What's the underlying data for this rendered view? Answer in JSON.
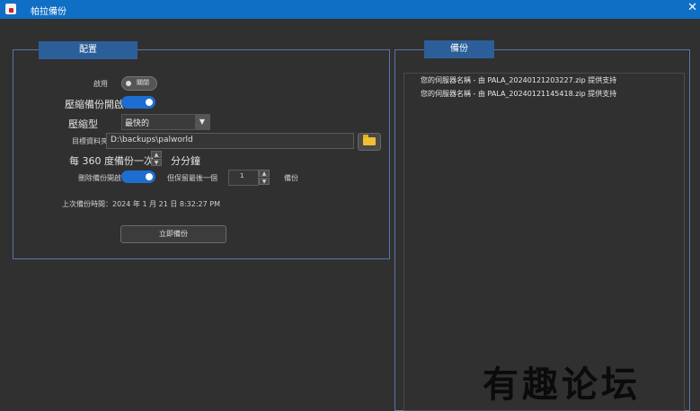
{
  "window": {
    "title": "帕拉備份",
    "close_glyph": "✕"
  },
  "config": {
    "tab_label": "配置",
    "enable": {
      "label": "啟用",
      "toggle_text": "關閉"
    },
    "compress_enable": {
      "label": "壓縮備份開啟"
    },
    "compress_type": {
      "label": "壓縮型",
      "value": "最快的",
      "arrow": "▼"
    },
    "target_folder": {
      "label": "目標資料夾",
      "value": "D:\\backups\\palworld"
    },
    "interval": {
      "prefix": "每",
      "value": "360",
      "suffix": "度備份一次",
      "unit": "分分鐘"
    },
    "delete_backup": {
      "label": "刪除備份開啟",
      "keep_label": "但保留最後一個",
      "keep_value": "1",
      "unit": "備份"
    },
    "last_backup": "上次備份時間：2024 年 1 月 21 日 8:32:27 PM",
    "backup_now": "立即備份"
  },
  "backups": {
    "tab_label": "備份",
    "items": [
      "您的伺服器名稱 - 由 PALA_20240121203227.zip 提供支持",
      "您的伺服器名稱 - 由 PALA_20240121145418.zip 提供支持"
    ]
  },
  "watermark": "有趣论坛",
  "colors": {
    "titlebar": "#0f6fc4",
    "accent": "#1d6ed0",
    "panel_border": "#5578a8",
    "tab": "#2c5f99"
  }
}
